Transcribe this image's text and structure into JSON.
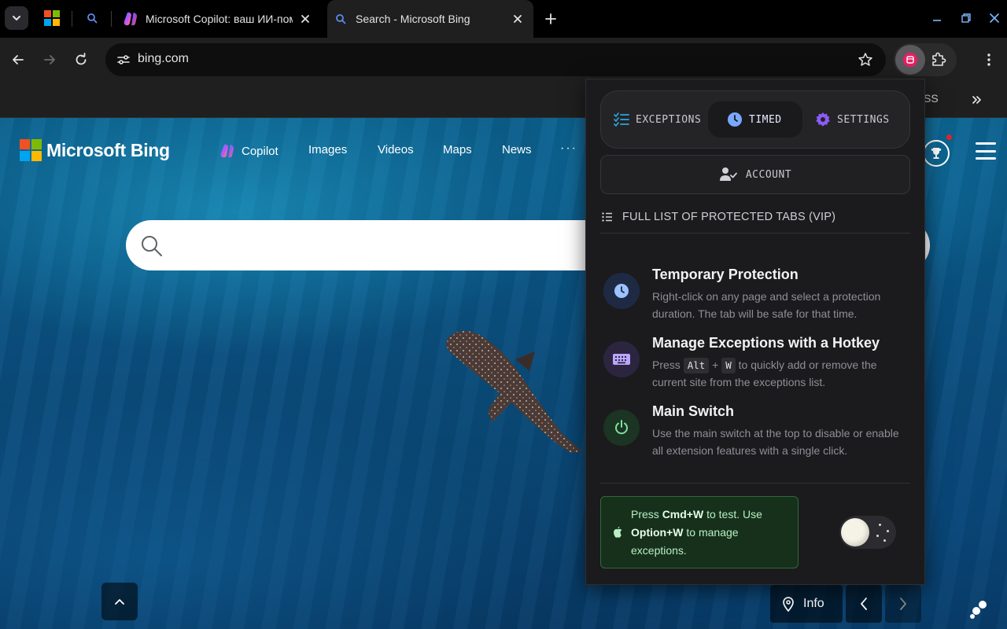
{
  "browser": {
    "tabs": [
      {
        "title": "Microsoft Copilot: ваш ИИ-помощник",
        "active": false
      },
      {
        "title": "Search - Microsoft Bing",
        "active": true
      }
    ],
    "url": "bing.com",
    "bookmarks_partial_text": "SS"
  },
  "bing": {
    "logo_text": "Microsoft Bing",
    "nav": [
      "Copilot",
      "Images",
      "Videos",
      "Maps",
      "News"
    ],
    "more": "···",
    "search_placeholder": "",
    "info_label": "Info"
  },
  "popup": {
    "tabs": [
      {
        "label": "EXCEPTIONS",
        "icon": "checklist-icon",
        "color": "#2ea7e0"
      },
      {
        "label": "TIMED",
        "icon": "clock-icon",
        "color": "#7aa7ff",
        "active": true
      },
      {
        "label": "SETTINGS",
        "icon": "gear-icon",
        "color": "#8b5cf6"
      }
    ],
    "account_label": "ACCOUNT",
    "full_list_label": "FULL LIST OF PROTECTED TABS (VIP)",
    "features": [
      {
        "title": "Temporary Protection",
        "desc": "Right-click on any page and select a protection duration. The tab will be safe for that time.",
        "icon": "clock-icon",
        "icon_color": "#9cc2ff",
        "bg": "#1e2a44"
      },
      {
        "title": "Manage Exceptions with a Hotkey",
        "desc_before": "Press",
        "key1": "Alt",
        "plus": "+",
        "key2": "W",
        "desc_after": "to quickly add or remove the current site from the exceptions list.",
        "icon": "keyboard-icon",
        "icon_color": "#b9a6ff",
        "bg": "#2b2540"
      },
      {
        "title": "Main Switch",
        "desc": "Use the main switch at the top to disable or enable all extension features with a single click.",
        "icon": "power-icon",
        "icon_color": "#7ee29a",
        "bg": "#1b3424"
      }
    ],
    "tip": {
      "t1": "Press ",
      "b1": "Cmd+W",
      "t2": " to test. Use ",
      "b2": "Option+W",
      "t3": " to manage exceptions."
    },
    "theme_toggle": "dark"
  }
}
